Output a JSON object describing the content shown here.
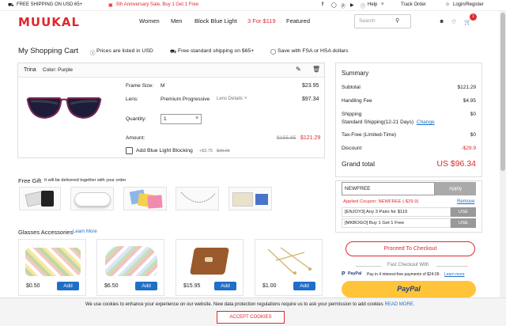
{
  "topbar": {
    "shipping": "FREE SHIPPING ON USD 65+",
    "promo": "5th Anniversary Sale, Buy 1 Get 1 Free",
    "help": "Help",
    "track": "Track Order",
    "login": "Login/Register"
  },
  "header": {
    "logo": "MUUKAL",
    "nav": [
      "Women",
      "Men",
      "Block Blue Light",
      "3 For $119",
      "Featured"
    ],
    "search_placeholder": "Search",
    "cart_count": "1"
  },
  "cart": {
    "title": "My Shopping Cart",
    "info1": "Prices are listed in USD",
    "info2": "Free standard shipping on $65+",
    "info3": "Save with FSA or HSA dollars",
    "item": {
      "name": "Trina",
      "color": "Color: Purple",
      "frame_size_label": "Frame Size:",
      "frame_size": "M",
      "frame_price": "$23.95",
      "lens_label": "Lens:",
      "lens": "Premium Progressive",
      "lens_details": "Lens Details",
      "lens_price": "$97.34",
      "quantity_label": "Quantity:",
      "quantity": "1",
      "amount_label": "Amount:",
      "amount_old": "$155.85",
      "amount_new": "$121.29",
      "blue_light_label": "Add Blue Light Blocking",
      "blue_light_add": "+$3.75",
      "blue_light_old": "$29.95"
    },
    "free_gift_title": "Free Gift",
    "free_gift_note": "It will be delivered together with your order",
    "accessories_title": "Glasses Accessories",
    "learn_more": "Learn More",
    "accessories": [
      {
        "price": "$0.50",
        "add": "Add"
      },
      {
        "price": "$6.50",
        "add": "Add"
      },
      {
        "price": "$15.95",
        "add": "Add"
      },
      {
        "price": "$1.00",
        "add": "Add"
      }
    ]
  },
  "summary": {
    "title": "Summary",
    "subtotal_label": "Subtotal",
    "subtotal": "$121.29",
    "handling_label": "Handling Fee",
    "handling": "$4.95",
    "shipping_label": "Shipping",
    "shipping": "$0",
    "shipping_method": "Standard Shipping(12-21 Days)",
    "change": "Change",
    "tax_label": "Tax-Free (Limited-Time)",
    "tax": "$0",
    "discount_label": "Discount",
    "discount": "-$29.9",
    "grand_label": "Grand total",
    "grand": "US $96.34",
    "coupon_value": "NEWFREE",
    "apply": "Apply",
    "applied": "Applied Coupon: NEWFREE (-$29.9)",
    "remove": "Remove",
    "codes": [
      {
        "text": "[ENJOY3]  Any 3 Pairs for $119",
        "use": "USE"
      },
      {
        "text": "[MKBOGO]  Buy 1 Get 1 Free",
        "use": "USE"
      }
    ],
    "checkout": "Proceed To Checkout",
    "fast": "Fast Checkout With",
    "paypal_note": "Pay in 4 interest-free payments of $24.09.",
    "paypal_learn": "Learn more",
    "paypal_btn": "PayPal"
  },
  "cookie": {
    "text": "We use cookies to enhance your experience on our website. New data protection regulations require us to ask your permission to add cookies",
    "read_more": "READ MORE.",
    "accept": "ACCEPT COOKIES"
  },
  "colors": {
    "brand": "#e0282e",
    "blue": "#1f6fc7",
    "paypal": "#ffc439"
  }
}
